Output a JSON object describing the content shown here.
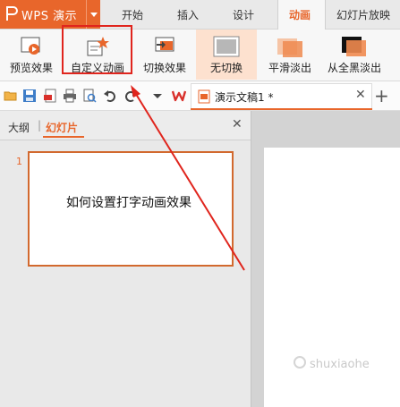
{
  "app": {
    "name": "WPS 演示"
  },
  "menu_tabs": [
    "开始",
    "插入",
    "设计",
    "动画",
    "幻灯片放映"
  ],
  "ribbon": {
    "preview": "预览效果",
    "custom_animation": "自定义动画",
    "switch_effect": "切换效果",
    "no_switch": "无切换",
    "smooth_fade": "平滑淡出",
    "black_fade": "从全黑淡出"
  },
  "document_tab": {
    "title": "演示文稿1 *"
  },
  "panel": {
    "outline": "大纲",
    "separator": "|",
    "slides": "幻灯片"
  },
  "slides": [
    {
      "number": "1",
      "text": "如何设置打字动画效果"
    }
  ],
  "watermark": "shuxiaohe",
  "colors": {
    "accent": "#e8662b",
    "highlight": "#e0251d"
  }
}
